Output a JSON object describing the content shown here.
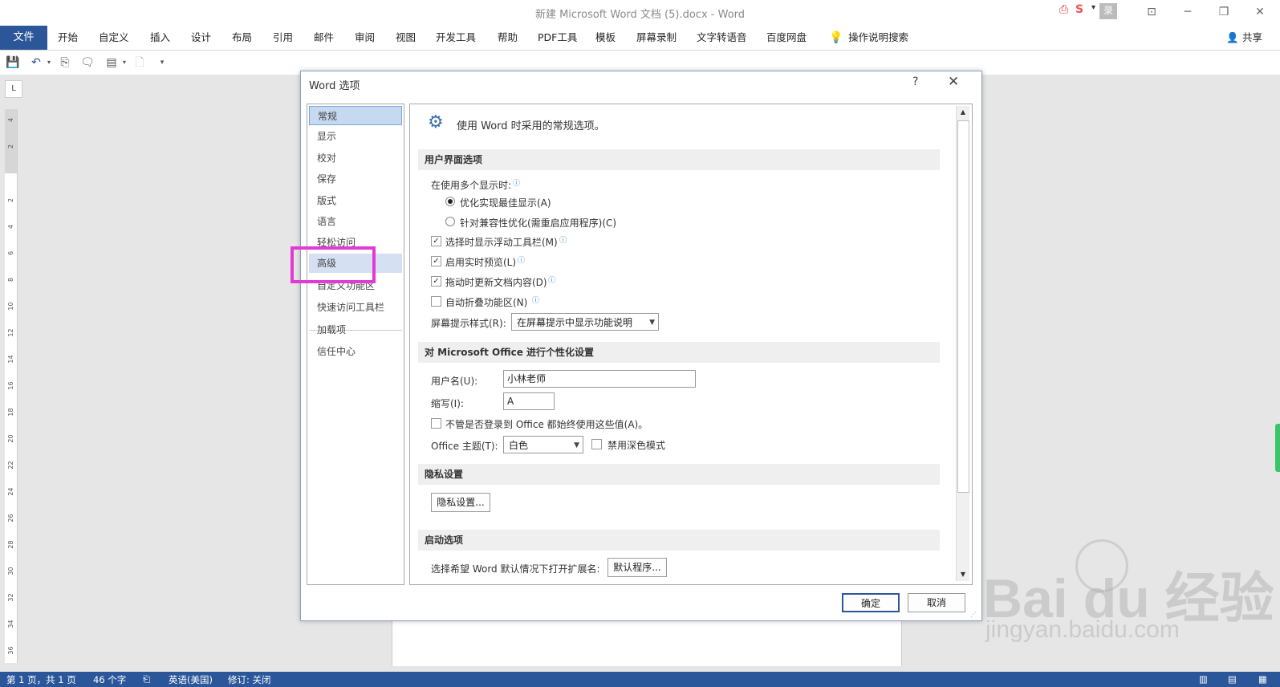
{
  "window": {
    "title": "新建 Microsoft Word 文档 (5).docx  -  Word",
    "share_label": "共享",
    "tray_text": "录"
  },
  "ribbon": {
    "file_tab": "文件",
    "tabs": [
      "开始",
      "自定义",
      "插入",
      "设计",
      "布局",
      "引用",
      "邮件",
      "审阅",
      "视图",
      "开发工具",
      "帮助",
      "PDF工具",
      "模板",
      "屏幕录制",
      "文字转语音",
      "百度网盘"
    ],
    "tell_me": "操作说明搜索"
  },
  "ruler": {
    "corner": "L",
    "numbers": [
      "4",
      "2",
      "",
      "2",
      "4",
      "6",
      "8",
      "10",
      "12",
      "14",
      "16",
      "18",
      "20",
      "22",
      "24",
      "26",
      "28",
      "30",
      "32",
      "34",
      "36",
      "38"
    ]
  },
  "dialog": {
    "title": "Word 选项",
    "help": "?",
    "close": "✕",
    "nav": {
      "items": [
        "常规",
        "显示",
        "校对",
        "保存",
        "版式",
        "语言",
        "轻松访问",
        "高级",
        "自定义功能区",
        "快速访问工具栏",
        "加载项",
        "信任中心"
      ],
      "selected": "常规",
      "highlighted": "高级"
    },
    "header": "使用 Word 时采用的常规选项。",
    "ui_section": {
      "title": "用户界面选项",
      "multi_display_label": "在使用多个显示时:",
      "radio_best": "优化实现最佳显示(A)",
      "radio_compat": "针对兼容性优化(需重启应用程序)(C)",
      "mini_toolbar": "选择时显示浮动工具栏(M)",
      "live_preview": "启用实时预览(L)",
      "update_drag": "拖动时更新文档内容(D)",
      "collapse_ribbon": "自动折叠功能区(N)",
      "screentip_label": "屏幕提示样式(R):",
      "screentip_value": "在屏幕提示中显示功能说明"
    },
    "personalize_section": {
      "title": "对 Microsoft Office 进行个性化设置",
      "username_label": "用户名(U):",
      "username_value": "小林老师",
      "initials_label": "缩写(I):",
      "initials_value": "A",
      "always_use": "不管是否登录到 Office 都始终使用这些值(A)。",
      "theme_label": "Office 主题(T):",
      "theme_value": "白色",
      "dark_mode": "禁用深色模式"
    },
    "privacy_section": {
      "title": "隐私设置",
      "button": "隐私设置..."
    },
    "startup_section": {
      "title": "启动选项",
      "default_ext_label": "选择希望 Word 默认情况下打开扩展名:",
      "default_programs": "默认程序..."
    },
    "ok": "确定",
    "cancel": "取消"
  },
  "status": {
    "page": "第 1 页，共 1 页",
    "words": "46 个字",
    "language": "英语(美国)",
    "track": "修订: 关闭"
  },
  "watermark": {
    "logo": "Bai du 经验",
    "sub": "jingyan.baidu.com"
  },
  "colors": {
    "accent": "#2b579a",
    "highlight_box": "#e23ad6",
    "nav_selected": "#c5d9f1"
  }
}
